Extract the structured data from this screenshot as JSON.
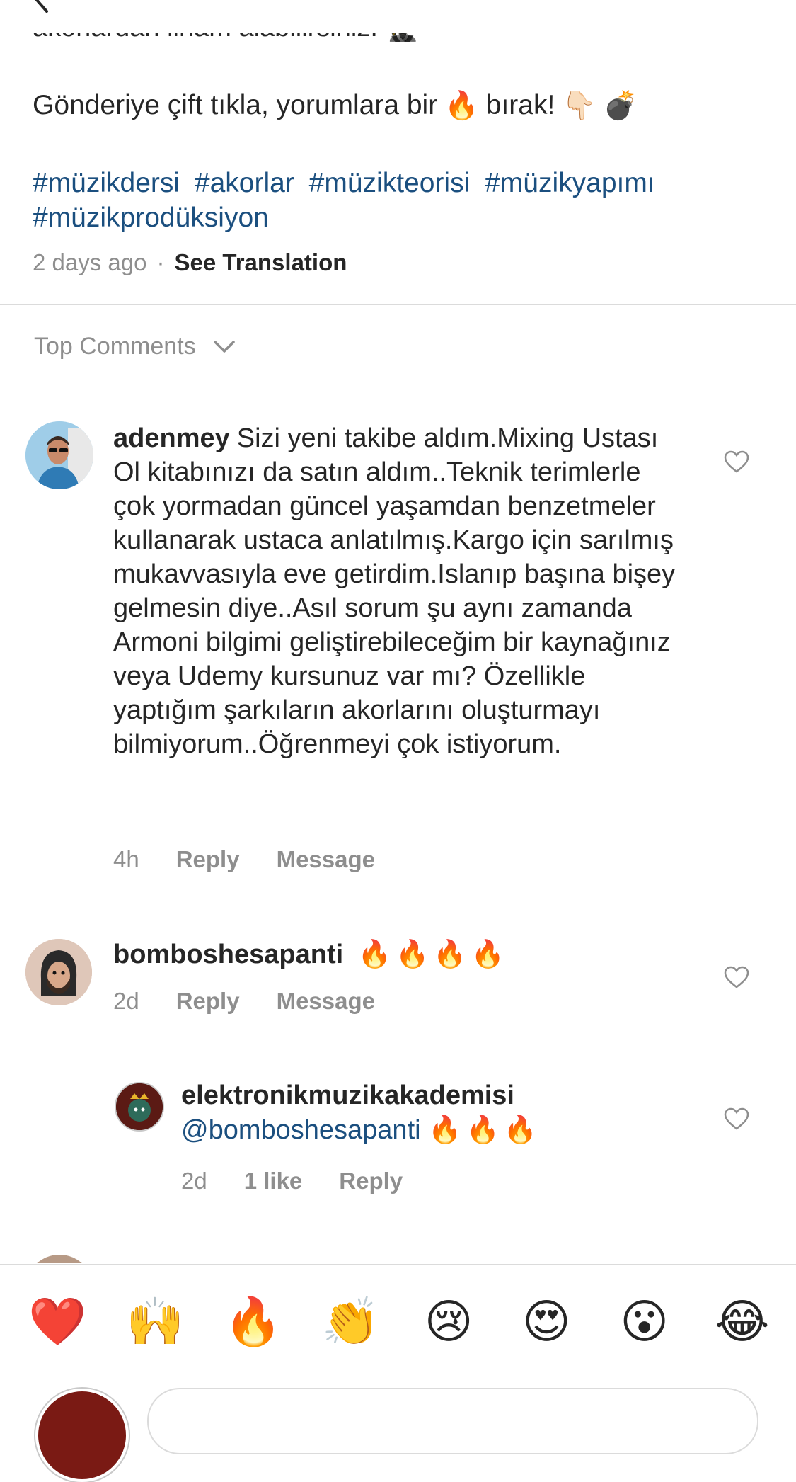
{
  "caption": {
    "clipped_line": "akorlardan ilham alabilirsiniz.",
    "cta_text": "Gönderiye çift tıkla, yorumlara bir",
    "cta_end": "bırak!",
    "hashtags": [
      "#müzikdersi",
      "#akorlar",
      "#müzikteorisi",
      "#müzikyapımı",
      "#müzikprodüksiyon"
    ],
    "time": "2 days ago",
    "translate": "See Translation"
  },
  "top_comments_label": "Top Comments",
  "comments": [
    {
      "username": "adenmey",
      "text": "Sizi yeni takibe aldım.Mixing Ustası Ol kitabınızı da satın aldım..Teknik terimlerle çok yormadan güncel yaşamdan benzetmeler kullanarak ustaca anlatılmış.Kargo için sarılmış mukavvasıyla eve getirdim.Islanıp başına bişey gelmesin diye..Asıl sorum şu aynı zamanda Armoni bilgimi geliştirebileceğim bir kaynağınız veya Udemy kursunuz var mı? Özellikle yaptığım şarkıların akorlarını oluşturmayı bilmiyorum..Öğrenmeyi çok istiyorum.",
      "time": "4h",
      "reply": "Reply",
      "message": "Message"
    },
    {
      "username": "bomboshesapanti",
      "text": "🔥🔥🔥🔥",
      "time": "2d",
      "reply": "Reply",
      "message": "Message"
    },
    {
      "username": "elektronikmuzikakademisi",
      "mention": "@bomboshesapanti",
      "text": "🔥🔥🔥",
      "time": "2d",
      "likes": "1 like",
      "reply": "Reply"
    }
  ],
  "reactions": [
    "❤️",
    "🙌",
    "🔥",
    "👏",
    "😢",
    "😍",
    "😮",
    "😂"
  ],
  "colors": {
    "link": "#1b4f7f",
    "muted": "#8e8e8e",
    "text": "#262626",
    "divider": "#dbdbdb"
  }
}
